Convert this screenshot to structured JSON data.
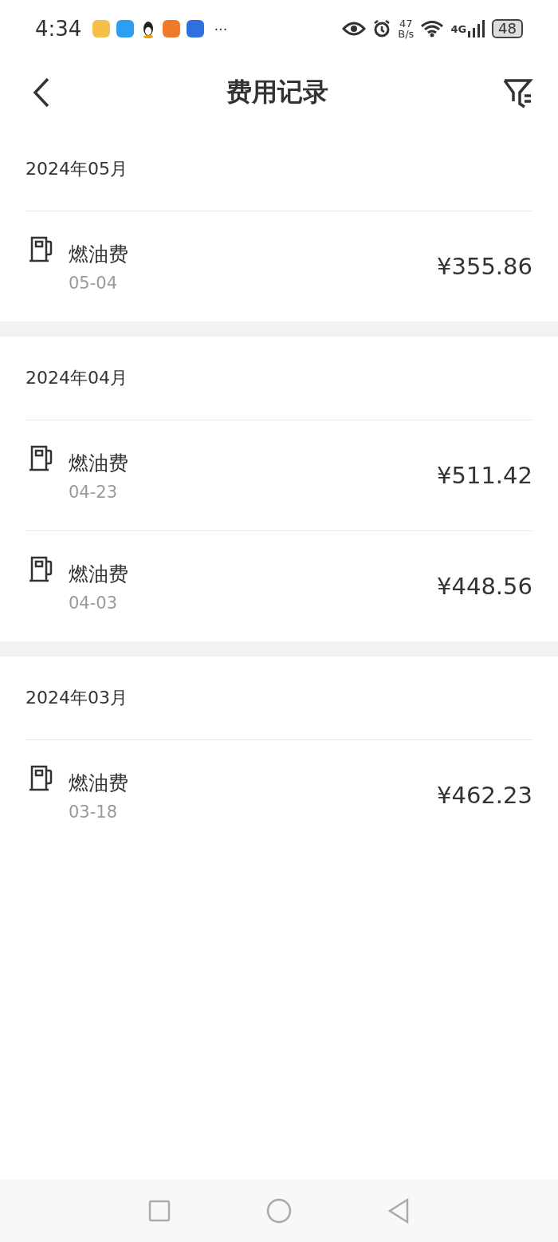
{
  "status_bar": {
    "time": "4:34",
    "more": "···",
    "speed_value": "47",
    "speed_unit": "B/s",
    "network": "4G",
    "battery": "48"
  },
  "header": {
    "title": "费用记录"
  },
  "groups": [
    {
      "month": "2024年05月",
      "records": [
        {
          "name": "燃油费",
          "date": "05-04",
          "amount": "¥355.86"
        }
      ]
    },
    {
      "month": "2024年04月",
      "records": [
        {
          "name": "燃油费",
          "date": "04-23",
          "amount": "¥511.42"
        },
        {
          "name": "燃油费",
          "date": "04-03",
          "amount": "¥448.56"
        }
      ]
    },
    {
      "month": "2024年03月",
      "records": [
        {
          "name": "燃油费",
          "date": "03-18",
          "amount": "¥462.23"
        }
      ]
    }
  ]
}
